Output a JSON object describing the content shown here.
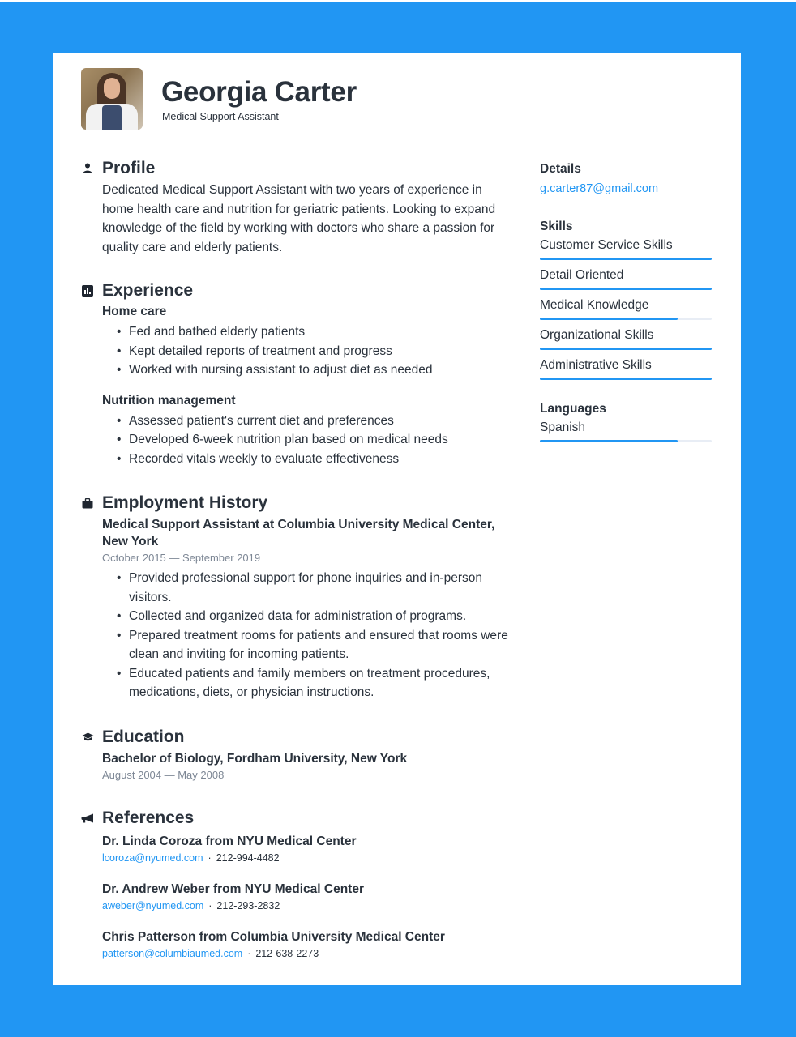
{
  "colors": {
    "background": "#2196f3",
    "accent": "#2196f3",
    "text": "#2a323c",
    "muted": "#7d8795"
  },
  "header": {
    "name": "Georgia Carter",
    "job_title": "Medical Support Assistant",
    "photo_alt": "profile-photo"
  },
  "profile": {
    "title": "Profile",
    "icon": "person-icon",
    "text": "Dedicated Medical Support Assistant with two years of experience in home health care and nutrition for geriatric patients. Looking to expand knowledge of the field by working with doctors who share a passion for quality care and elderly patients."
  },
  "experience": {
    "title": "Experience",
    "icon": "bar-chart-icon",
    "groups": [
      {
        "title": "Home care",
        "items": [
          "Fed and bathed elderly patients",
          "Kept detailed reports of treatment and progress",
          "Worked with nursing assistant to adjust diet as needed"
        ]
      },
      {
        "title": "Nutrition management",
        "items": [
          "Assessed patient's current diet and preferences",
          "Developed 6-week nutrition plan based on medical needs",
          "Recorded vitals weekly to evaluate effectiveness"
        ]
      }
    ]
  },
  "employment": {
    "title": "Employment History",
    "icon": "briefcase-icon",
    "jobs": [
      {
        "title": "Medical Support Assistant at Columbia University Medical Center, New York",
        "dates": "October 2015 — September 2019",
        "items": [
          "Provided professional support for phone inquiries and in-person visitors.",
          "Collected and organized data for administration of programs.",
          "Prepared treatment rooms for patients and ensured that rooms were clean and inviting for incoming patients.",
          "Educated patients and family members on treatment procedures, medications, diets, or physician instructions."
        ]
      }
    ]
  },
  "education": {
    "title": "Education",
    "icon": "graduation-cap-icon",
    "entries": [
      {
        "title": "Bachelor of Biology, Fordham University, New York",
        "dates": "August 2004 — May 2008"
      }
    ]
  },
  "references": {
    "title": "References",
    "icon": "megaphone-icon",
    "separator": "·",
    "entries": [
      {
        "name": "Dr. Linda Coroza from NYU Medical Center",
        "email": "lcoroza@nyumed.com",
        "phone": "212-994-4482"
      },
      {
        "name": "Dr. Andrew Weber from NYU Medical Center",
        "email": "aweber@nyumed.com",
        "phone": "212-293-2832"
      },
      {
        "name": "Chris Patterson from Columbia University Medical Center",
        "email": "patterson@columbiaumed.com",
        "phone": "212-638-2273"
      }
    ]
  },
  "sidebar": {
    "details": {
      "title": "Details",
      "email": "g.carter87@gmail.com"
    },
    "skills": {
      "title": "Skills",
      "items": [
        {
          "label": "Customer Service Skills",
          "level_percent": 100
        },
        {
          "label": "Detail Oriented",
          "level_percent": 100
        },
        {
          "label": "Medical Knowledge",
          "level_percent": 80
        },
        {
          "label": "Organizational Skills",
          "level_percent": 100
        },
        {
          "label": "Administrative Skills",
          "level_percent": 100
        }
      ]
    },
    "languages": {
      "title": "Languages",
      "items": [
        {
          "label": "Spanish",
          "level_percent": 80
        }
      ]
    }
  }
}
